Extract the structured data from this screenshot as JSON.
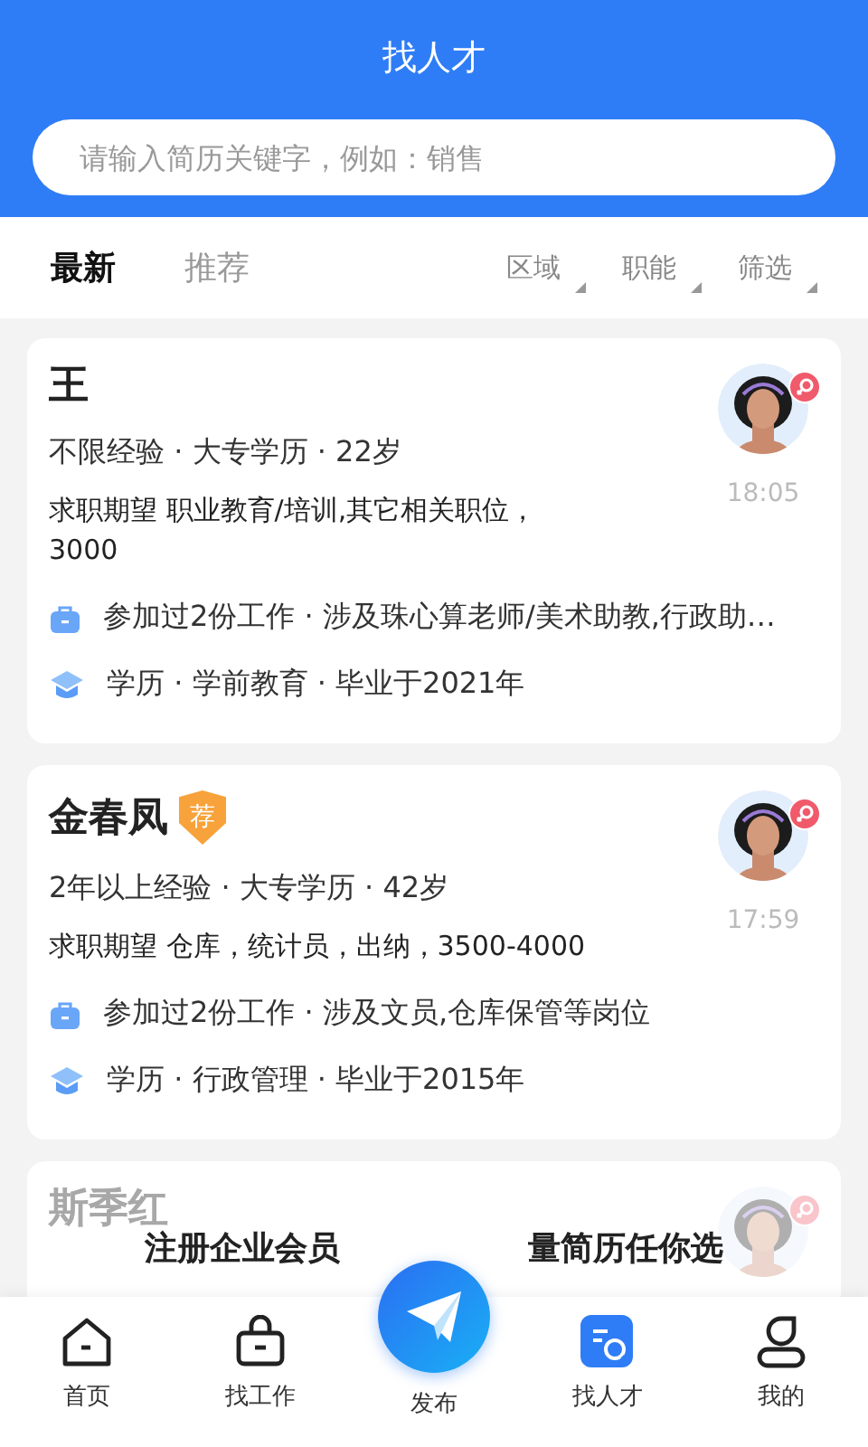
{
  "header": {
    "title": "找人才"
  },
  "search": {
    "placeholder": "请输入简历关键字，例如：销售"
  },
  "tabs": [
    {
      "label": "最新",
      "selected": true
    },
    {
      "label": "推荐",
      "selected": false
    }
  ],
  "filters": [
    {
      "label": "区域"
    },
    {
      "label": "职能"
    },
    {
      "label": "筛选"
    }
  ],
  "resumes": [
    {
      "name": "王",
      "summary": "不限经验 · 大专学历 · 22岁",
      "expectation": "求职期望 职业教育/培训,其它相关职位，\n3000",
      "time": "18:05",
      "work": "参加过2份工作 · 涉及珠心算老师/美术助教,行政助…",
      "education": "学历 · 学前教育 · 毕业于2021年",
      "faded": false
    },
    {
      "name": "金春凤",
      "badge": "荐",
      "summary": "2年以上经验 · 大专学历 · 42岁",
      "expectation": "求职期望 仓库，统计员，出纳，3500-4000",
      "time": "17:59",
      "work": "参加过2份工作 · 涉及文员,仓库保管等岗位",
      "education": "学历 · 行政管理 · 毕业于2015年",
      "faded": false
    },
    {
      "name": "斯季红",
      "faded": true
    }
  ],
  "promo": [
    "注册企业会员",
    "量简历任你选"
  ],
  "nav": [
    {
      "label": "首页",
      "kind": "home",
      "selected": false
    },
    {
      "label": "找工作",
      "kind": "jobs",
      "selected": false
    },
    {
      "label": "发布",
      "kind": "publish",
      "selected": false
    },
    {
      "label": "找人才",
      "kind": "talent",
      "selected": true
    },
    {
      "label": "我的",
      "kind": "me",
      "selected": false
    }
  ]
}
